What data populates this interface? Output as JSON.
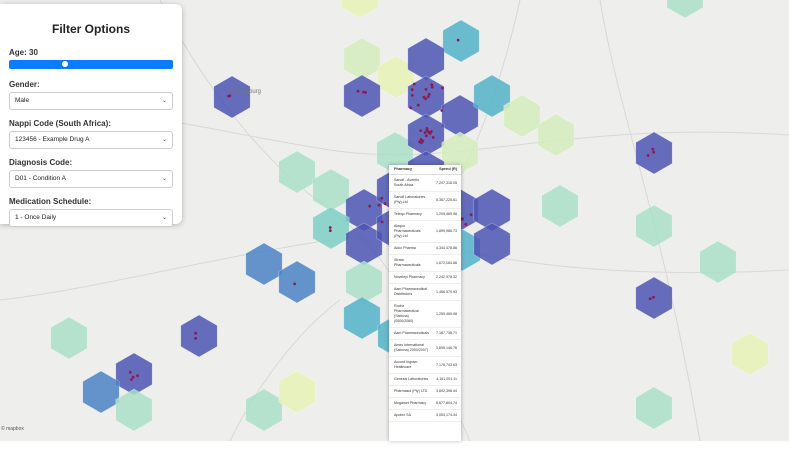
{
  "panel": {
    "title": "Filter Options",
    "age_label": "Age: 30",
    "age_value": 30,
    "gender_label": "Gender:",
    "gender_value": "Male",
    "nappi_label": "Nappi Code (South Africa):",
    "nappi_value": "123456 - Example Drug A",
    "diagnosis_label": "Diagnosis Code:",
    "diagnosis_value": "D01 - Condition A",
    "schedule_label": "Medication Schedule:",
    "schedule_value": "1 - Once Daily"
  },
  "map": {
    "attribution": "© mapbox",
    "city_label": "Rustenburg",
    "colors": {
      "very_high": "#4b55b3",
      "high": "#4a82c4",
      "mid": "#52b2c8",
      "low_mid": "#7ccfc4",
      "low": "#a9dfc8",
      "very_low": "#d5ecbe",
      "lowest": "#e6f2b6",
      "point": "#8b1a55"
    }
  },
  "tooltip": {
    "header_pharmacy": "Pharmacy",
    "header_spend": "Spend (R)",
    "rows": [
      {
        "pharmacy": "Sanofi - Aventis South Africa",
        "spend": "7,297,318.05"
      },
      {
        "pharmacy": "Sanofi Laboratories (Pty) Ltd",
        "spend": "5,367,225.61"
      },
      {
        "pharmacy": "Teleqo Pharmacy",
        "spend": "1,209,469.98"
      },
      {
        "pharmacy": "Aleqco Pharmaceuticals (Pty) Ltd",
        "spend": "1,899,986.73"
      },
      {
        "pharmacy": "Adco Pharma",
        "spend": "4,344,478.86"
      },
      {
        "pharmacy": "Strata Pharmaceuticals",
        "spend": "1,672,184.86"
      },
      {
        "pharmacy": "Noveleyi Pharmacy",
        "spend": "2,242,978.32"
      },
      {
        "pharmacy": "Aam Pharmaceutical Distributors",
        "spend": "1,466,570.93"
      },
      {
        "pharmacy": "Roche Pharmaceutical (Sabona) (0000/2060)",
        "spend": "1,259,469.98"
      },
      {
        "pharmacy": "Aam Pharmaceuticals",
        "spend": "7,187,735.71"
      },
      {
        "pharmacy": "Amec International (Sabona) 2000/2007)",
        "spend": "3,695,146.76"
      },
      {
        "pharmacy": "Accord Ingram Healthcare",
        "spend": "7,176,743.63"
      },
      {
        "pharmacy": "Genesis Laboratories",
        "spend": "4,161,001.11"
      },
      {
        "pharmacy": "Pharmasol (Pty) LTD",
        "spend": "3,692,396.44"
      },
      {
        "pharmacy": "Mogamet Pharmacy",
        "spend": "6,677,804.74"
      },
      {
        "pharmacy": "Apotex SA",
        "spend": "3,053,174.44"
      }
    ]
  }
}
